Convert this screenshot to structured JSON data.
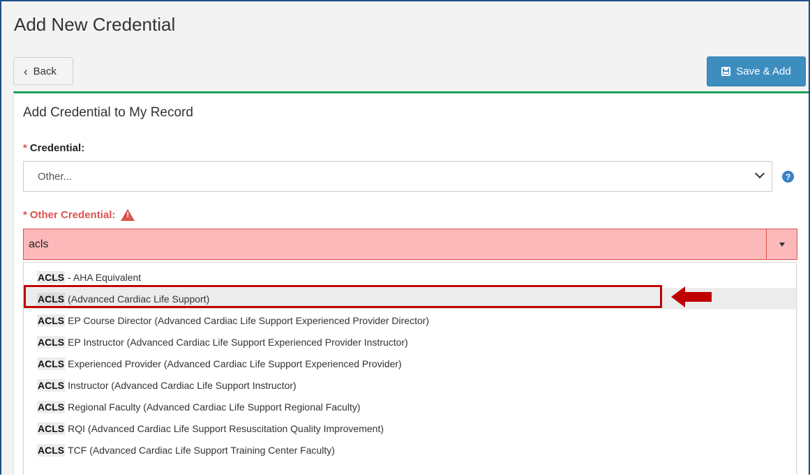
{
  "page": {
    "title": "Add New Credential"
  },
  "toolbar": {
    "back_label": "Back",
    "save_label": "Save & Add"
  },
  "panel": {
    "heading": "Add Credential to My Record",
    "credential": {
      "label": "Credential:",
      "required_marker": "*",
      "selected_value": "Other...",
      "help_glyph": "?"
    },
    "other_credential": {
      "label": "Other Credential:",
      "required_marker": "*",
      "input_value": "acls",
      "warn_glyph": "!"
    }
  },
  "dropdown": {
    "options": [
      {
        "keyword": "ACLS",
        "rest": "- AHA Equivalent"
      },
      {
        "keyword": "ACLS",
        "rest": "(Advanced Cardiac Life Support)"
      },
      {
        "keyword": "ACLS",
        "rest": "EP Course Director (Advanced Cardiac Life Support Experienced Provider Director)"
      },
      {
        "keyword": "ACLS",
        "rest": "EP Instructor (Advanced Cardiac Life Support Experienced Provider Instructor)"
      },
      {
        "keyword": "ACLS",
        "rest": "Experienced Provider (Advanced Cardiac Life Support Experienced Provider)"
      },
      {
        "keyword": "ACLS",
        "rest": "Instructor (Advanced Cardiac Life Support Instructor)"
      },
      {
        "keyword": "ACLS",
        "rest": "Regional Faculty (Advanced Cardiac Life Support Regional Faculty)"
      },
      {
        "keyword": "ACLS",
        "rest": "RQI (Advanced Cardiac Life Support Resuscitation Quality Improvement)"
      },
      {
        "keyword": "ACLS",
        "rest": "TCF (Advanced Cardiac Life Support Training Center Faculty)"
      }
    ],
    "highlighted_index": 1
  },
  "colors": {
    "accent_green": "#1aa15a",
    "save_blue": "#3d8ebf",
    "error_red": "#d9534f",
    "annotation_red": "#c00000"
  }
}
